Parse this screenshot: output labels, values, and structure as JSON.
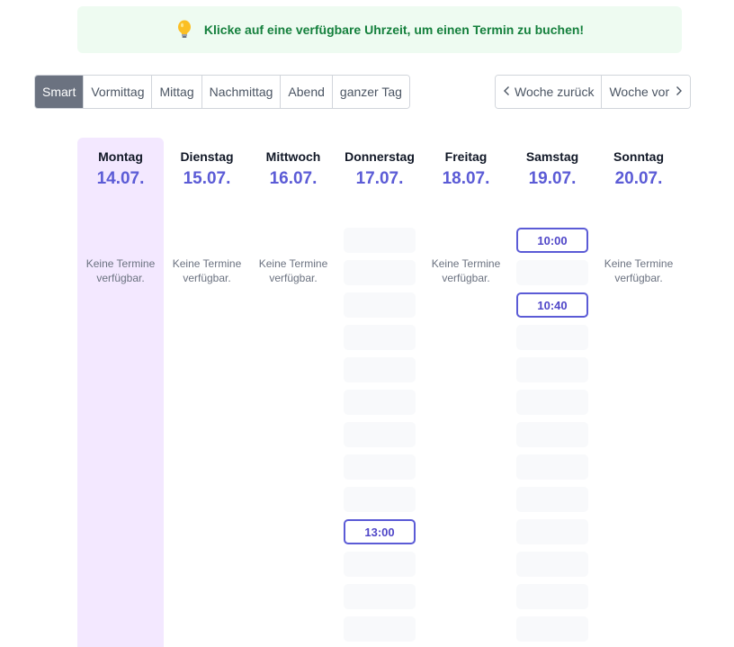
{
  "banner": {
    "icon": "lightbulb-icon",
    "text": "Klicke auf eine verfügbare Uhrzeit, um einen Termin zu buchen!"
  },
  "filters": {
    "active": "Smart",
    "items": [
      "Smart",
      "Vormittag",
      "Mittag",
      "Nachmittag",
      "Abend",
      "ganzer Tag"
    ]
  },
  "week_nav": {
    "prev_label": "Woche zurück",
    "next_label": "Woche vor"
  },
  "colors": {
    "date": "#5b5bd6",
    "today_bg": "#f3e8ff",
    "banner_bg": "#eefbf1",
    "banner_text": "#15803d",
    "active_filter": "#6b7280"
  },
  "days": [
    {
      "name": "Montag",
      "date": "14.07.",
      "today": true,
      "empty_text": "Keine Termine verfügbar.",
      "slots": []
    },
    {
      "name": "Dienstag",
      "date": "15.07.",
      "empty_text": "Keine Termine verfügbar.",
      "slots": []
    },
    {
      "name": "Mittwoch",
      "date": "16.07.",
      "empty_text": "Keine Termine verfügbar.",
      "slots": []
    },
    {
      "name": "Donnerstag",
      "date": "17.07.",
      "slots": [
        "",
        "",
        "",
        "",
        "",
        "",
        "",
        "",
        "",
        "13:00",
        "",
        "",
        ""
      ]
    },
    {
      "name": "Freitag",
      "date": "18.07.",
      "empty_text": "Keine Termine verfügbar.",
      "slots": []
    },
    {
      "name": "Samstag",
      "date": "19.07.",
      "slots": [
        "10:00",
        "",
        "10:40",
        "",
        "",
        "",
        "",
        "",
        "",
        "",
        "",
        "",
        ""
      ]
    },
    {
      "name": "Sonntag",
      "date": "20.07.",
      "empty_text": "Keine Termine verfügbar.",
      "slots": []
    }
  ]
}
